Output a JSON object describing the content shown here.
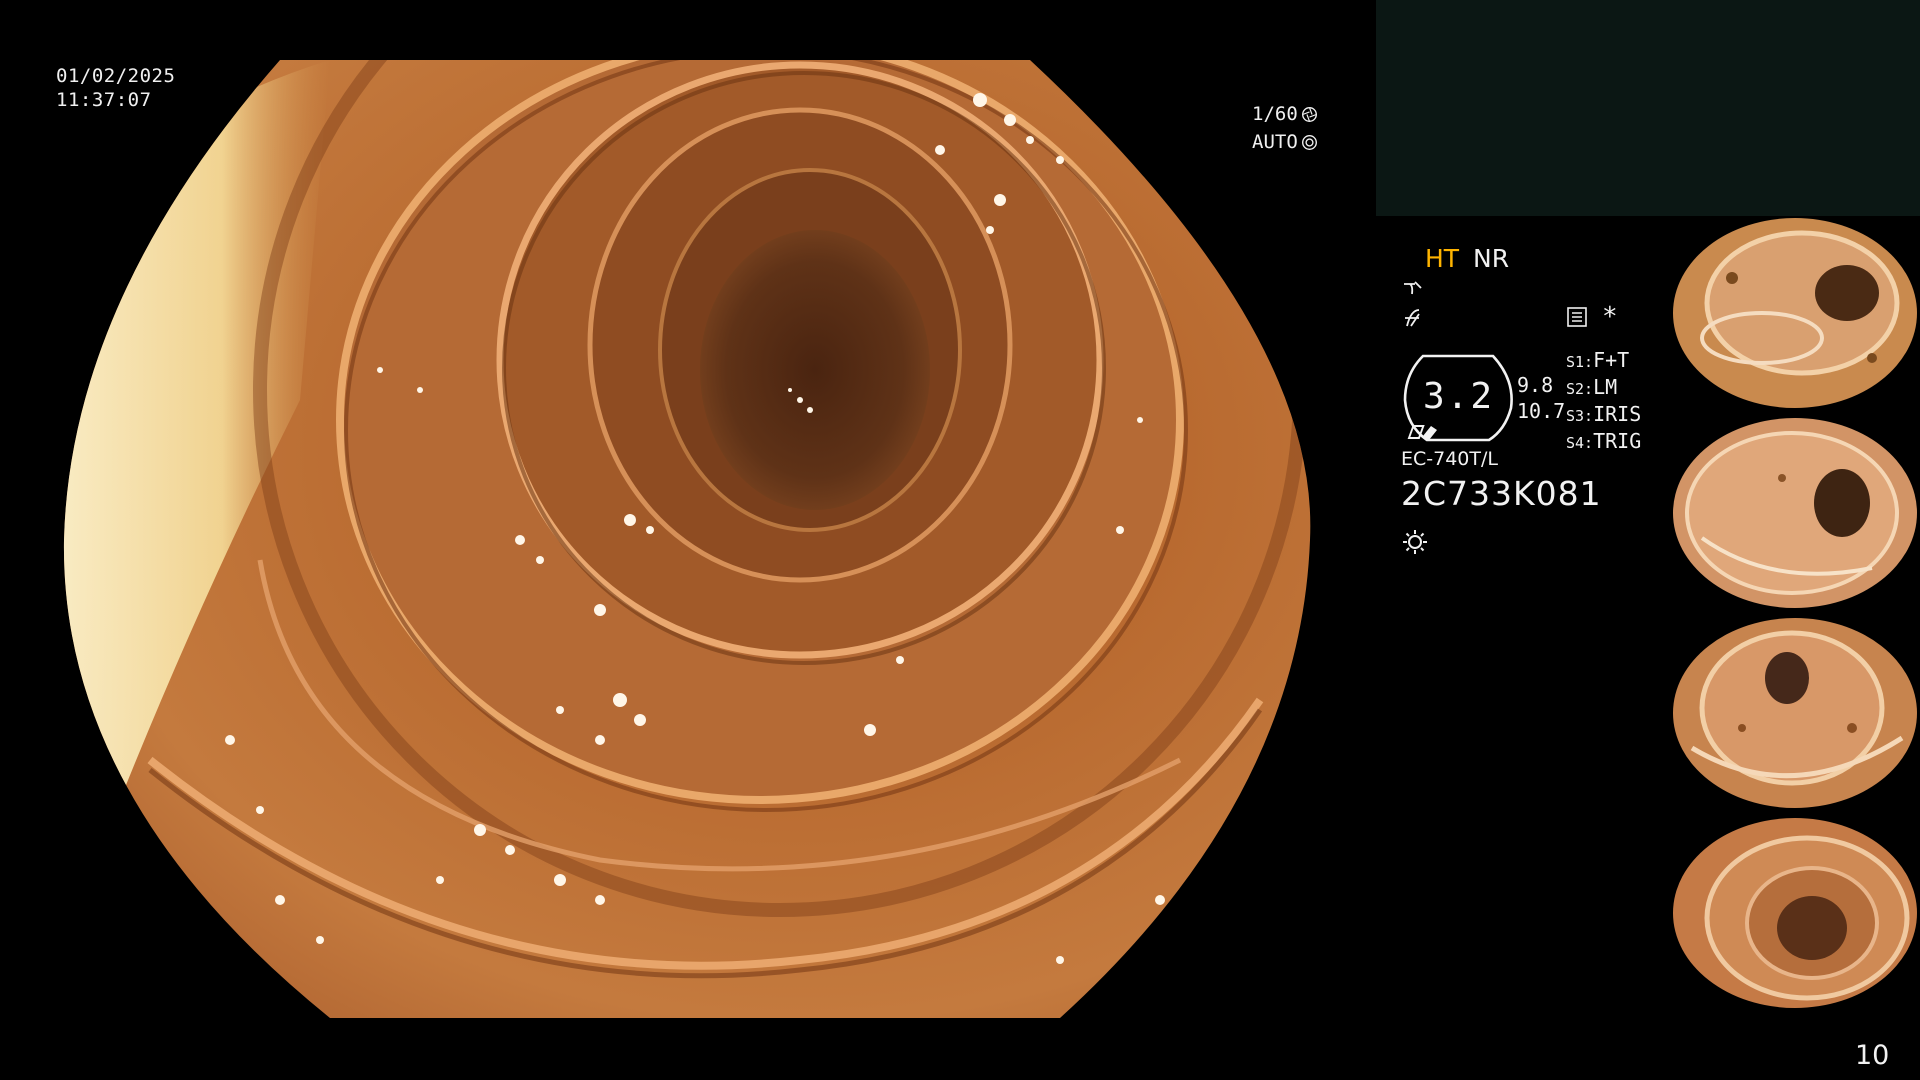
{
  "osd": {
    "date": "01/02/2025",
    "time": "11:37:07",
    "shutter": "1/60",
    "iris": "AUTO"
  },
  "info_panel": {
    "mode_ht": "HT",
    "mode_nr": "NR",
    "gauge_value": "3.2",
    "gauge_val_1": "9.8",
    "gauge_val_2": "10.7",
    "scope_model": "EC-740T/L",
    "scope_serial": "2C733K081"
  },
  "settings": [
    {
      "key": "S1:",
      "value": "F+T"
    },
    {
      "key": "S2:",
      "value": "LM"
    },
    {
      "key": "S3:",
      "value": "IRIS"
    },
    {
      "key": "S4:",
      "value": "TRIG"
    }
  ],
  "page_number": "10",
  "colors": {
    "ht_accent": "#ffb400",
    "top_panel": "#0b1714",
    "mucosa": "#b86a32"
  },
  "icons": [
    "shutter-icon",
    "iris-icon",
    "curve-icon",
    "contrast-icon",
    "menu-icon",
    "asterisk-icon",
    "light-icon"
  ]
}
